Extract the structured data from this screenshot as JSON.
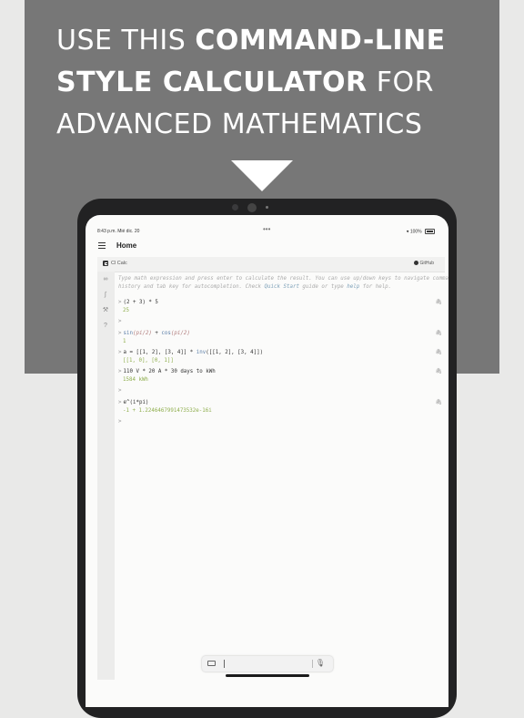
{
  "headline": {
    "line1_regular": "USE THIS",
    "line1_bold": "COMMAND-LINE",
    "line2_bold": "STYLE CALCULATOR",
    "line2_regular": "FOR",
    "line3_regular": "ADVANCED MATHEMATICS"
  },
  "status_bar": {
    "time": "8:43 p.m.  Mié dic. 20",
    "dots": "•••",
    "battery": "100%"
  },
  "topbar": {
    "title": "Home"
  },
  "app": {
    "name": "Cl Calc",
    "github_label": "GitHub"
  },
  "intro": {
    "line1": "Type math expression and press enter to calculate the result. You can use up/down keys to navigate command",
    "line2a": "history and tab key for autocompletion. Check ",
    "quick_start": "Quick Start",
    "line2b": " guide or type ",
    "help": "help",
    "line2c": " for help."
  },
  "entries": [
    {
      "prompt": ">",
      "input": "(2 + 3) * 5",
      "output": "25"
    },
    {
      "prompt": ">",
      "input_fn1": "sin",
      "input_arg1": "(pi/2)",
      "input_mid": " + ",
      "input_fn2": "cos",
      "input_arg2": "(pi/2)",
      "output": "1"
    },
    {
      "prompt": ">",
      "input_a": "a = [[1, 2], [3, 4]] * ",
      "input_fn": "inv",
      "input_b": "([[1, 2], [3, 4]])",
      "output": "[[1, 0], [0, 1]]"
    },
    {
      "prompt": ">",
      "input": "110 V * 20 A * 30 days to kWh",
      "output": "1584 kWh"
    },
    {
      "prompt": ">",
      "input": "e^(i*pi)",
      "output": "-1 + 1.2246467991473532e-16i"
    }
  ],
  "empty_prompt": ">",
  "icons": {
    "menu": "hamburger-icon",
    "copy": "paperclip-icon",
    "rail": [
      "link-icon",
      "function-icon",
      "wrench-icon",
      "help-icon"
    ],
    "keyboard": "keyboard-icon",
    "mic": "microphone-icon"
  }
}
